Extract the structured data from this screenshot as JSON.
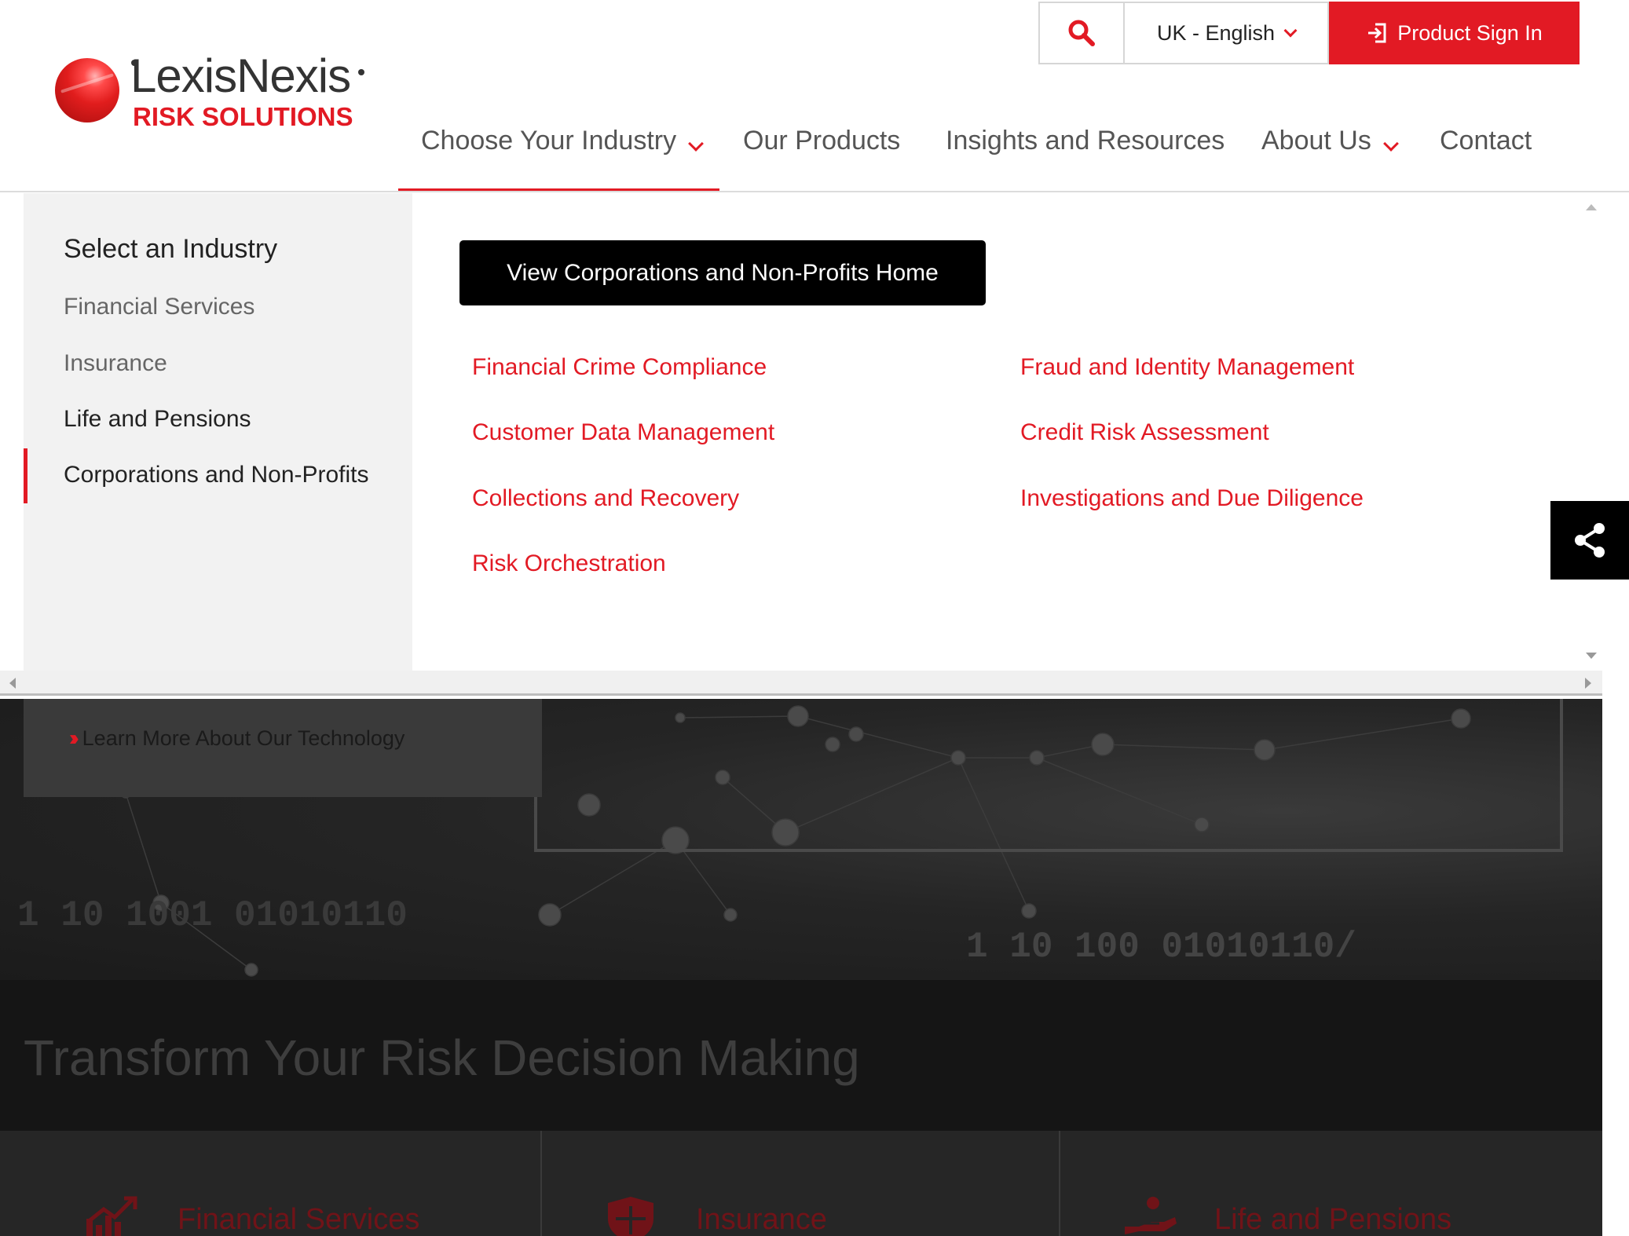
{
  "logo": {
    "wordmark": "LexisNexis",
    "subtitle": "RISK SOLUTIONS"
  },
  "utility": {
    "search_icon": "search-icon",
    "language": "UK - English",
    "signin": "Product Sign In"
  },
  "nav": [
    {
      "label": "Choose Your Industry"
    },
    {
      "label": "Our Products"
    },
    {
      "label": "Insights and Resources"
    },
    {
      "label": "About Us"
    },
    {
      "label": "Contact"
    }
  ],
  "menu": {
    "heading": "Select an Industry",
    "industries": [
      {
        "label": "Financial Services"
      },
      {
        "label": "Insurance"
      },
      {
        "label": "Life and Pensions"
      },
      {
        "label": "Corporations and Non-Profits"
      }
    ],
    "home_button": "View Corporations and Non-Profits Home",
    "solutions_left": [
      "Financial Crime Compliance",
      "Customer Data Management",
      "Collections and Recovery",
      "Risk Orchestration"
    ],
    "solutions_right": [
      "Fraud and Identity Management",
      "Credit Risk Assessment",
      "Investigations and Due Diligence"
    ]
  },
  "hero": {
    "learn_more": "Learn More About Our Technology",
    "binary_left": "1 10 1001 01010110",
    "binary_right": "1 10 100 01010110/"
  },
  "band": {
    "title": "Transform Your Risk Decision Making"
  },
  "cards": [
    {
      "title": "Financial Services",
      "icon": "chart-growth-icon"
    },
    {
      "title": "Insurance",
      "icon": "shield-icon"
    },
    {
      "title": "Life and Pensions",
      "icon": "hand-coins-icon"
    }
  ],
  "colors": {
    "brand_red": "#e21a24",
    "black": "#000000",
    "menu_grey": "#f2f2f2"
  }
}
